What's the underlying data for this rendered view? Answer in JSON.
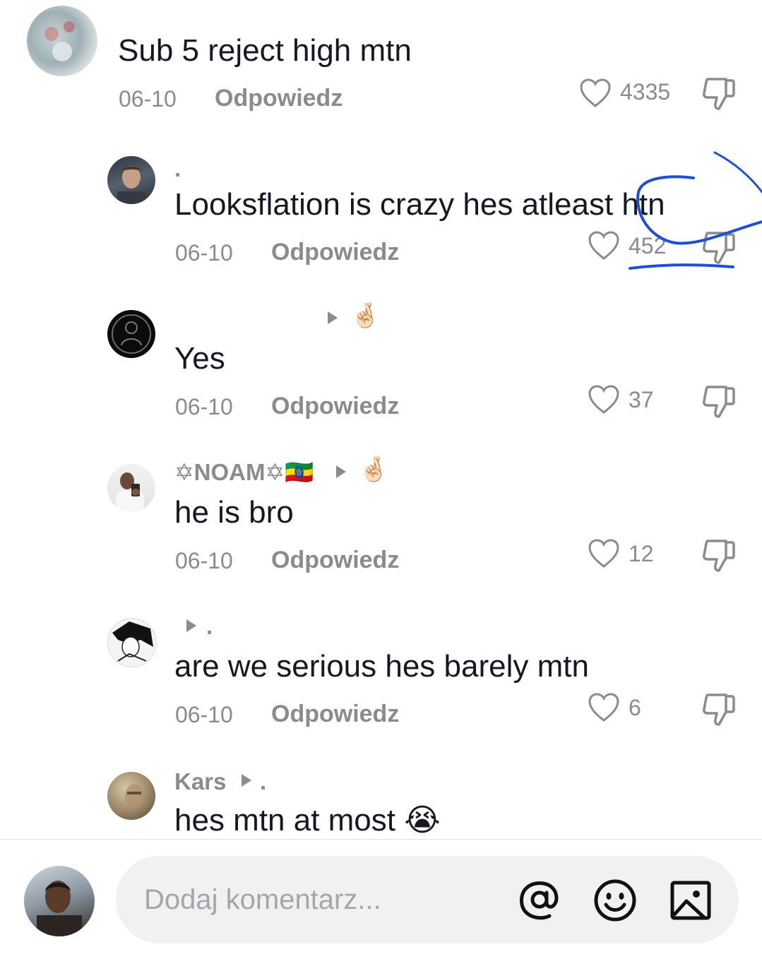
{
  "colors": {
    "text": "#161823",
    "muted": "#8a8b91",
    "annotation": "#1f4fd6",
    "input_bg": "#f1f1f2"
  },
  "comments": [
    {
      "username": "",
      "text": "Sub 5 reject high mtn",
      "date": "06-10",
      "reply": "Odpowiedz",
      "likes": "4335",
      "avatar": "abstract-avatar"
    },
    {
      "username": ".",
      "text": "Looksflation is crazy hes atleast htn",
      "date": "06-10",
      "reply": "Odpowiedz",
      "likes": "452",
      "avatar": "man-avatar"
    },
    {
      "username": "",
      "text": "Yes",
      "date": "06-10",
      "reply": "Odpowiedz",
      "likes": "37",
      "avatar": "dark-logo-avatar",
      "badge_emoji": "🤞🏻"
    },
    {
      "username": "✡NOAM✡🇪🇹",
      "text": "he is bro",
      "date": "06-10",
      "reply": "Odpowiedz",
      "likes": "12",
      "avatar": "selfie-avatar",
      "badge_emoji": "🤞🏻"
    },
    {
      "username": ".",
      "text": "are we serious hes barely mtn",
      "date": "06-10",
      "reply": "Odpowiedz",
      "likes": "6",
      "avatar": "anime-avatar"
    },
    {
      "username": "Kars",
      "username_suffix": ".",
      "text": "hes mtn at most",
      "emoji": "😭",
      "avatar": "kars-avatar"
    }
  ],
  "composer": {
    "placeholder": "Dodaj komentarz...",
    "icons": [
      "at-icon",
      "emoji-icon",
      "image-icon"
    ]
  }
}
